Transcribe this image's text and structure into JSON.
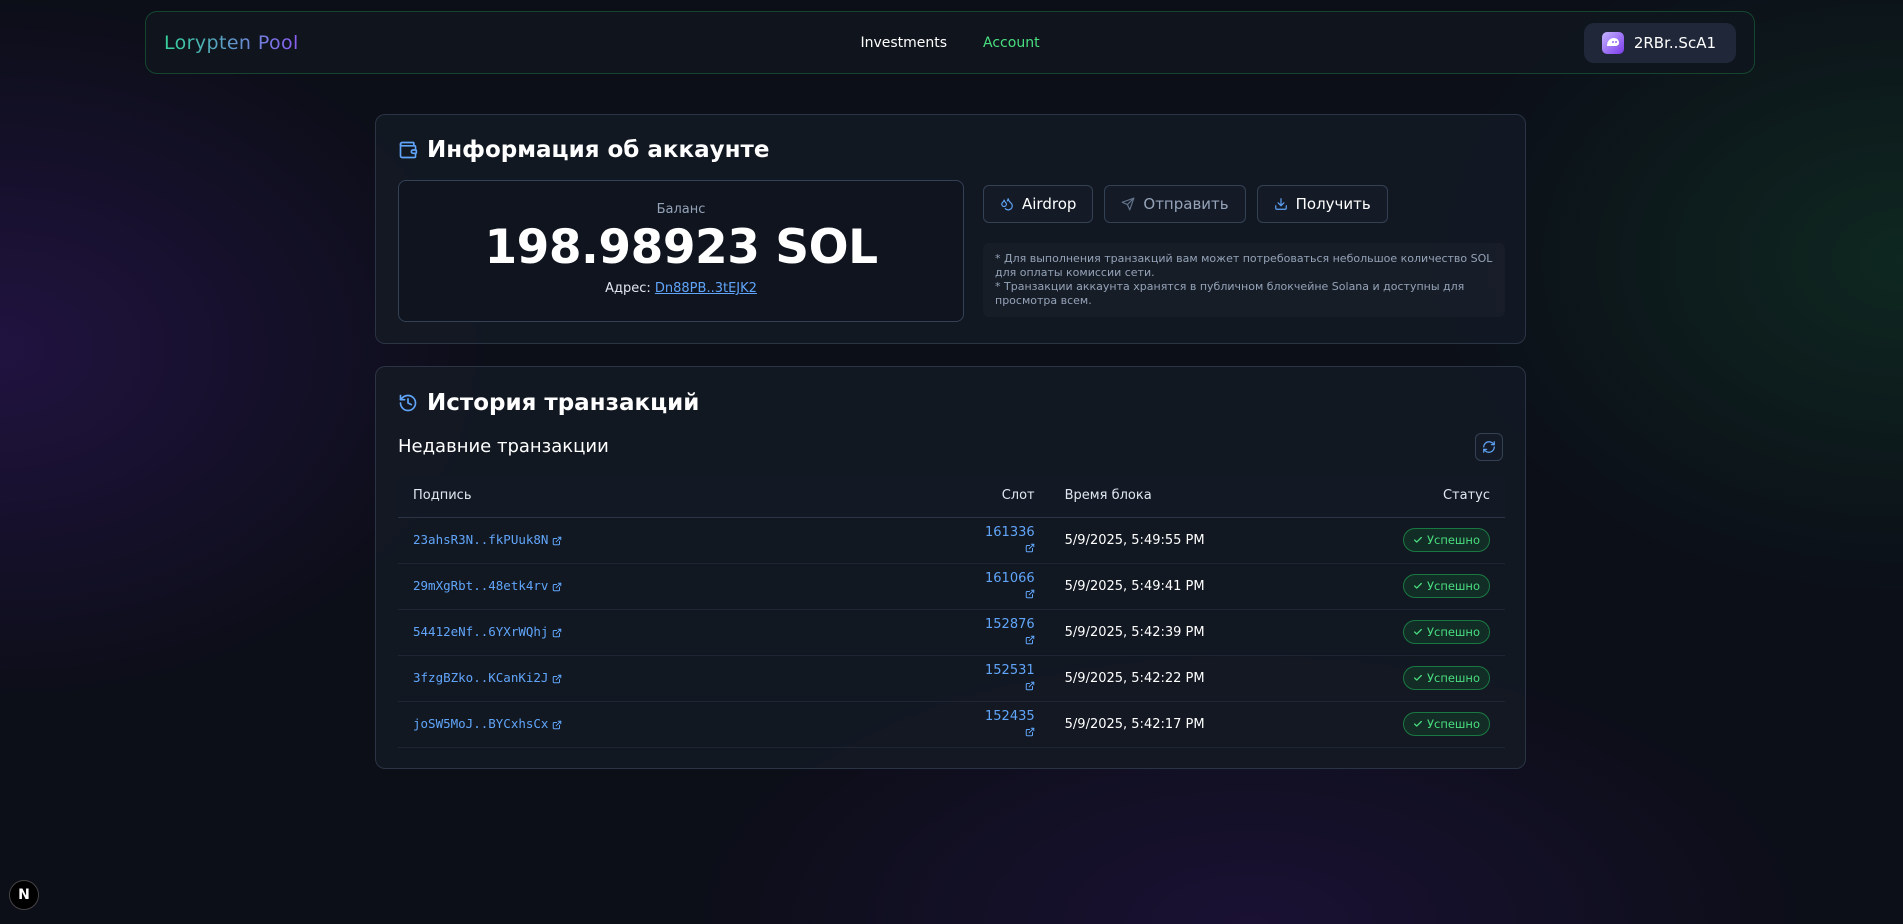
{
  "nav": {
    "brand": "Lorypten Pool",
    "links": [
      {
        "label": "Investments",
        "active": false
      },
      {
        "label": "Account",
        "active": true
      }
    ],
    "wallet_label": "2RBr..ScA1"
  },
  "account": {
    "title": "Информация об аккаунте",
    "balance_label": "Баланс",
    "balance_value": "198.98923 SOL",
    "address_prefix": "Адрес:",
    "address": "Dn88PB..3tEJK2",
    "actions": {
      "airdrop": "Airdrop",
      "send": "Отправить",
      "receive": "Получить"
    },
    "notes": [
      "* Для выполнения транзакций вам может потребоваться небольшое количество SOL для оплаты комиссии сети.",
      "* Транзакции аккаунта хранятся в публичном блокчейне Solana и доступны для просмотра всем."
    ]
  },
  "history": {
    "title": "История транзакций",
    "subtitle": "Недавние транзакции",
    "columns": {
      "signature": "Подпись",
      "slot": "Слот",
      "block_time": "Время блока",
      "status": "Статус"
    },
    "rows": [
      {
        "signature": "23ahsR3N..fkPUuk8N",
        "slot": "161336",
        "time": "5/9/2025, 5:49:55 PM",
        "status": "Успешно"
      },
      {
        "signature": "29mXgRbt..48etk4rv",
        "slot": "161066",
        "time": "5/9/2025, 5:49:41 PM",
        "status": "Успешно"
      },
      {
        "signature": "54412eNf..6YXrWQhj",
        "slot": "152876",
        "time": "5/9/2025, 5:42:39 PM",
        "status": "Успешно"
      },
      {
        "signature": "3fzgBZko..KCanKi2J",
        "slot": "152531",
        "time": "5/9/2025, 5:42:22 PM",
        "status": "Успешно"
      },
      {
        "signature": "joSW5MoJ..BYCxhsCx",
        "slot": "152435",
        "time": "5/9/2025, 5:42:17 PM",
        "status": "Успешно"
      }
    ]
  },
  "dev_badge": "N"
}
